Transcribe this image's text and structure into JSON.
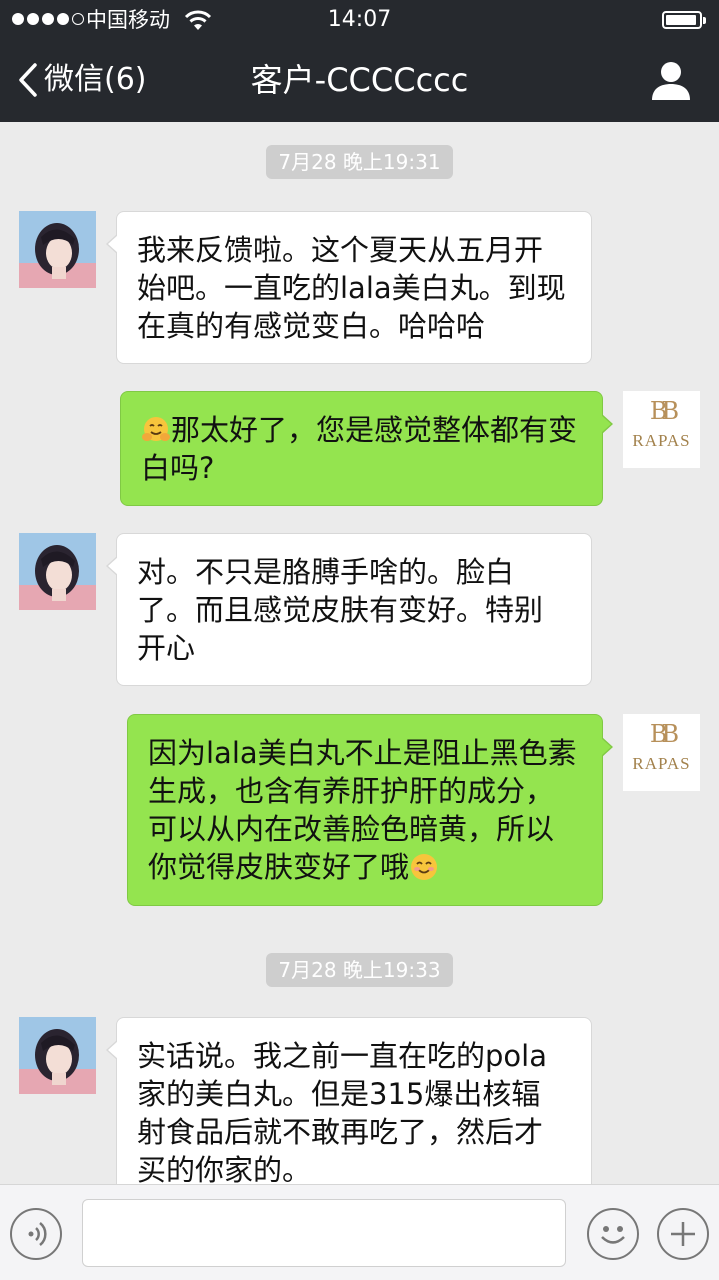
{
  "status_bar": {
    "carrier": "中国移动",
    "time": "14:07",
    "signal_bars_filled": 4,
    "signal_bars_total": 5
  },
  "nav": {
    "back_label": "微信(6)",
    "title": "客户-CCCCccc"
  },
  "brand": {
    "mark": "BB",
    "name": "RAPAS",
    "color": "#b7905a"
  },
  "colors": {
    "bar_background": "#26292e",
    "chat_background": "#ebebeb",
    "incoming_bubble": "#ffffff",
    "outgoing_bubble": "#94e44f"
  },
  "messages": [
    {
      "type": "timestamp",
      "text": "7月28 晚上19:31"
    },
    {
      "type": "incoming",
      "text": "我来反馈啦。这个夏天从五月开始吧。一直吃的lala美白丸。到现在真的有感觉变白。哈哈哈"
    },
    {
      "type": "outgoing",
      "emoji": "hugging-face",
      "text": "那太好了，您是感觉整体都有变白吗?"
    },
    {
      "type": "incoming",
      "text": "对。不只是胳膊手啥的。脸白了。而且感觉皮肤有变好。特别开心"
    },
    {
      "type": "outgoing",
      "text": "因为lala美白丸不止是阻止黑色素生成，也含有养肝护肝的成分，可以从内在改善脸色暗黄，所以你觉得皮肤变好了哦",
      "emoji_end": "smiling-face"
    },
    {
      "type": "timestamp",
      "text": "7月28 晚上19:33"
    },
    {
      "type": "incoming",
      "text": "实话说。我之前一直在吃的pola家的美白丸。但是315爆出核辐射食品后就不敢再吃了，然后才买的你家的。"
    }
  ],
  "input_bar": {
    "left_icon": "voice-icon",
    "emoji_icon": "emoji-icon",
    "plus_icon": "plus-icon",
    "value": ""
  }
}
